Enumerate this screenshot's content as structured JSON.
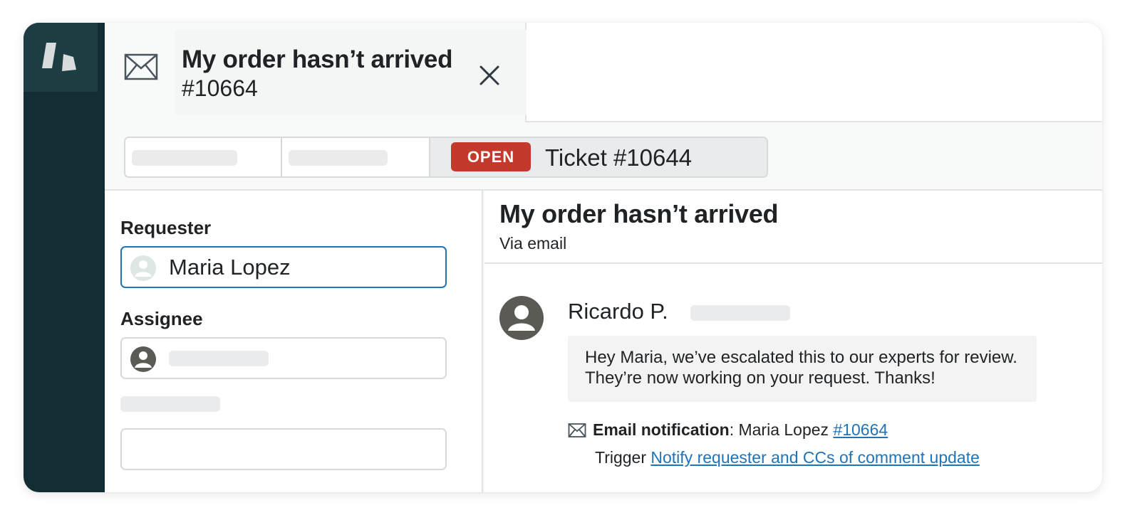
{
  "colors": {
    "rail": "#122e34",
    "status_open": "#c33a2c",
    "focus": "#1f73b7",
    "link": "#1f73b7"
  },
  "rail": {
    "logo_icon": "brand-logo-icon"
  },
  "header_tab": {
    "icon": "envelope-icon",
    "title": "My order hasn’t arrived",
    "number": "#10664",
    "close_icon": "close-icon"
  },
  "toolbar": {
    "status_badge": "OPEN",
    "ticket_label": "Ticket #10644"
  },
  "fields": {
    "requester": {
      "label": "Requester",
      "value": "Maria Lopez",
      "icon": "user-avatar-icon"
    },
    "assignee": {
      "label": "Assignee",
      "value": "",
      "icon": "user-avatar-icon"
    }
  },
  "conversation": {
    "title": "My order hasn’t arrived",
    "channel": "Via email",
    "comment": {
      "author": "Ricardo P.",
      "body_line1": "Hey Maria, we’ve escalated this to our experts for review.",
      "body_line2": "They’re now working on your request. Thanks!"
    },
    "notification": {
      "icon": "envelope-icon",
      "label": "Email notification",
      "sep": ": ",
      "recipient": "Maria Lopez ",
      "ticket_link": "#10664",
      "trigger_prefix": "Trigger ",
      "trigger_link": "Notify requester and CCs of comment update"
    }
  }
}
